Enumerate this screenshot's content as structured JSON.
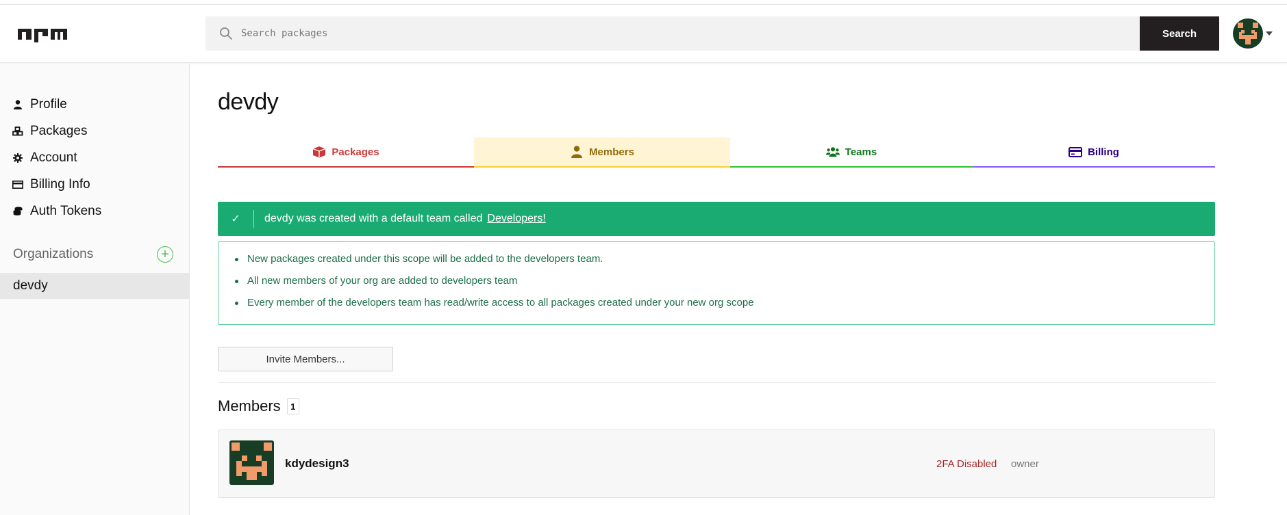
{
  "header": {
    "logo_text": "npm",
    "search_placeholder": "Search packages",
    "search_button": "Search",
    "avatar_icon": "user-avatar-icon"
  },
  "sidebar": {
    "items": [
      {
        "label": "Profile",
        "icon": "user-icon"
      },
      {
        "label": "Packages",
        "icon": "packages-icon"
      },
      {
        "label": "Account",
        "icon": "gear-icon"
      },
      {
        "label": "Billing Info",
        "icon": "credit-card-icon"
      },
      {
        "label": "Auth Tokens",
        "icon": "coins-icon"
      }
    ],
    "organizations_label": "Organizations",
    "add_org_symbol": "+",
    "orgs": [
      {
        "name": "devdy",
        "selected": true
      }
    ]
  },
  "main": {
    "title": "devdy",
    "tabs": [
      {
        "label": "Packages",
        "icon": "box-icon",
        "color": "#cb3837"
      },
      {
        "label": "Members",
        "icon": "user-icon",
        "color": "#8f6b0a",
        "active": true
      },
      {
        "label": "Teams",
        "icon": "users-icon",
        "color": "#11741c"
      },
      {
        "label": "Billing",
        "icon": "credit-card-icon",
        "color": "#2b0089"
      }
    ],
    "alert": {
      "check": "✓",
      "text": "devdy was created with a default team called",
      "link": "Developers!",
      "color": "#1aab73"
    },
    "info": [
      "New packages created under this scope will be added to the developers team.",
      "All new members of your org are added to developers team",
      "Every member of the developers team has read/write access to all packages created under your new org scope"
    ],
    "invite_button": "Invite Members...",
    "members_heading": "Members",
    "members_count": "1",
    "members": [
      {
        "username": "kdydesign3",
        "tfa_status": "2FA Disabled",
        "role": "owner"
      }
    ]
  }
}
